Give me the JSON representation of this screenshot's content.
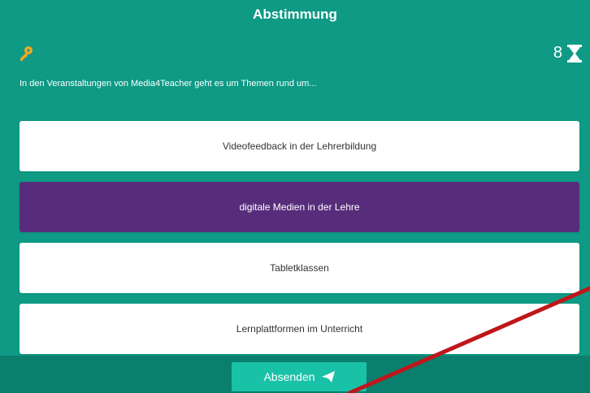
{
  "header": {
    "title": "Abstimmung"
  },
  "timer": {
    "value": "8",
    "icon": "hourglass-icon"
  },
  "key": {
    "icon": "key-icon",
    "color": "#f5a623"
  },
  "question": {
    "text": "In den Veranstaltungen von Media4Teacher geht es um Themen rund um..."
  },
  "answers": [
    {
      "label": "Videofeedback in der Lehrerbildung",
      "selected": false
    },
    {
      "label": "digitale Medien in der Lehre",
      "selected": true
    },
    {
      "label": "Tabletklassen",
      "selected": false
    },
    {
      "label": "Lernplattformen im Unterricht",
      "selected": false
    }
  ],
  "submit": {
    "label": "Absenden",
    "icon": "paper-plane-icon"
  },
  "colors": {
    "background": "#0e9a85",
    "footer": "#0a7f6d",
    "selected": "#572d7b",
    "button": "#19c1a7",
    "annotation_line": "#c0161a"
  }
}
